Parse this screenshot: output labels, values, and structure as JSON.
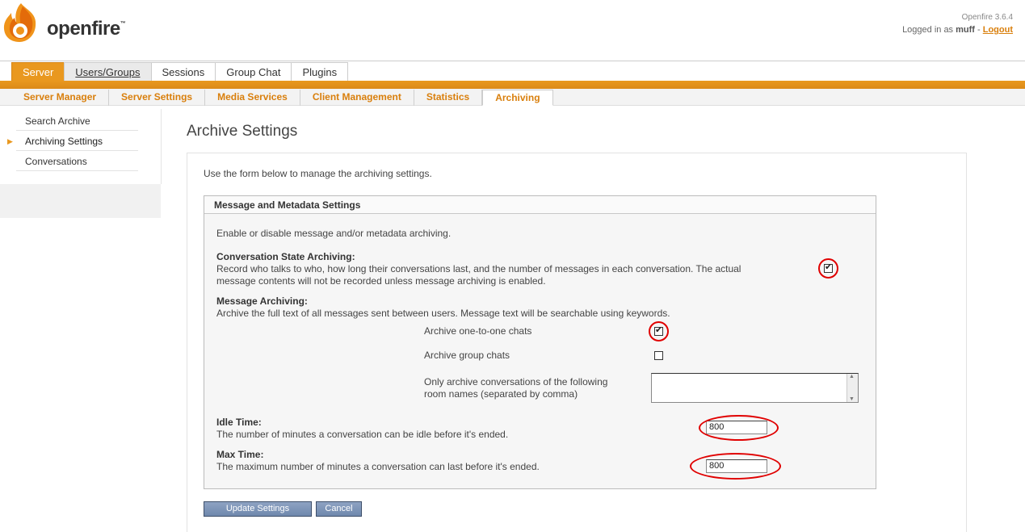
{
  "header": {
    "logo_text": "openfire",
    "trademark": "™",
    "version": "Openfire 3.6.4",
    "logged_in_prefix": "Logged in as ",
    "username": "muff",
    "separator": " - ",
    "logout_label": "Logout"
  },
  "main_tabs": [
    {
      "label": "Server",
      "active": true
    },
    {
      "label": "Users/Groups",
      "hover": true
    },
    {
      "label": "Sessions"
    },
    {
      "label": "Group Chat"
    },
    {
      "label": "Plugins"
    }
  ],
  "sub_tabs": [
    {
      "label": "Server Manager"
    },
    {
      "label": "Server Settings"
    },
    {
      "label": "Media Services"
    },
    {
      "label": "Client Management"
    },
    {
      "label": "Statistics"
    },
    {
      "label": "Archiving",
      "active": true
    }
  ],
  "sidebar": {
    "items": [
      {
        "label": "Search Archive"
      },
      {
        "label": "Archiving Settings",
        "active": true
      },
      {
        "label": "Conversations"
      }
    ]
  },
  "page": {
    "title": "Archive Settings",
    "intro": "Use the form below to manage the archiving settings."
  },
  "panel": {
    "title": "Message and Metadata Settings",
    "description": "Enable or disable message and/or metadata archiving.",
    "conversation_state": {
      "label": "Conversation State Archiving:",
      "desc_line1": "Record who talks to who, how long their conversations last, and the number of messages in each conversation. The actual",
      "desc_line2": "message contents will not be recorded unless message archiving is enabled.",
      "checked": true
    },
    "message_archiving": {
      "label": "Message Archiving:",
      "desc": "Archive the full text of all messages sent between users. Message text will be searchable using keywords.",
      "one_to_one_label": "Archive one-to-one chats",
      "one_to_one_checked": true,
      "group_label": "Archive group chats",
      "group_checked": false,
      "rooms_label_line1": "Only archive conversations of the following",
      "rooms_label_line2": "room names (separated by comma)",
      "rooms_value": ""
    },
    "idle_time": {
      "label": "Idle Time:",
      "desc": "The number of minutes a conversation can be idle before it's ended.",
      "value": "800"
    },
    "max_time": {
      "label": "Max Time:",
      "desc": "The maximum number of minutes a conversation can last before it's ended.",
      "value": "800"
    }
  },
  "buttons": {
    "update_label": "Update Settings",
    "cancel_label": "Cancel"
  },
  "colors": {
    "accent_orange": "#e9981f",
    "link_orange": "#d97f0c",
    "annotation_red": "#e00000",
    "button_blue": "#7b92b6"
  },
  "icons": [
    "openfire-flame-logo-icon",
    "sidebar-arrow-icon",
    "checkmark-icon",
    "scroll-up-icon",
    "scroll-down-icon"
  ]
}
